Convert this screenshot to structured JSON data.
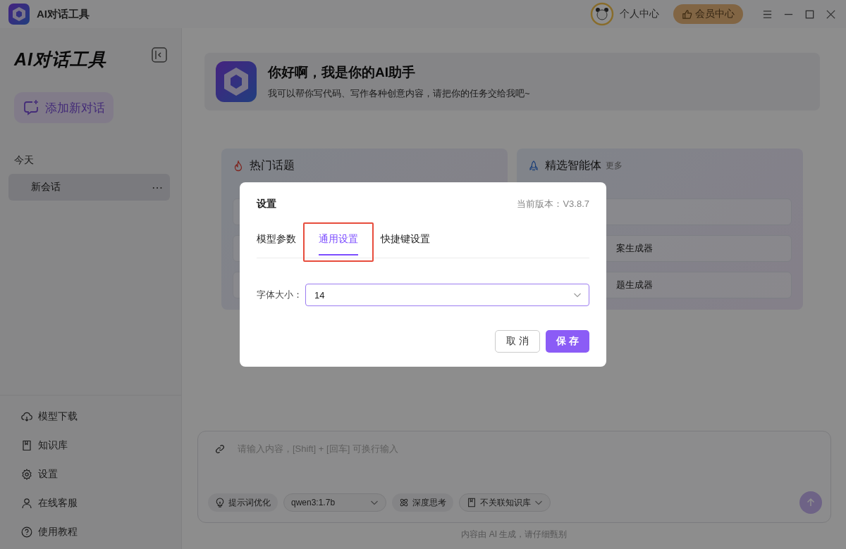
{
  "window": {
    "title": "AI对话工具"
  },
  "header": {
    "user_label": "个人中心",
    "vip_button": "会员中心"
  },
  "sidebar": {
    "logo": "AI对话工具",
    "new_chat_button": "添加新对话",
    "groups": [
      {
        "label": "今天",
        "items": [
          {
            "title": "新会话",
            "selected": true,
            "more": "⋯"
          }
        ]
      }
    ],
    "bottom_items": [
      {
        "kind": "cloud",
        "label": "模型下载"
      },
      {
        "kind": "book",
        "label": "知识库"
      },
      {
        "kind": "gear",
        "label": "设置"
      },
      {
        "kind": "person",
        "label": "在线客服"
      },
      {
        "kind": "help",
        "label": "使用教程"
      }
    ]
  },
  "welcome": {
    "title": "你好啊，我是你的AI助手",
    "subtitle": "我可以帮你写代码、写作各种创意内容，请把你的任务交给我吧~"
  },
  "cards": [
    {
      "kind": "fire",
      "title": "热门话题"
    },
    {
      "kind": "rocket",
      "title": "精选智能体",
      "more": "更多",
      "items": [
        "案生成器",
        "题生成器"
      ]
    }
  ],
  "composer": {
    "placeholder": "请输入内容，[Shift] + [回车] 可换行输入",
    "chips": [
      {
        "kind": "bulb",
        "label": "提示词优化"
      },
      {
        "kind": "select",
        "label": "qwen3:1.7b"
      },
      {
        "kind": "atom",
        "label": "深度思考"
      },
      {
        "kind": "book-select",
        "label": "不关联知识库"
      }
    ]
  },
  "footer_note": "内容由 AI 生成，请仔细甄别",
  "dialog": {
    "title": "设置",
    "version": "当前版本：V3.8.7",
    "tabs": [
      {
        "label": "模型参数",
        "selected": false,
        "highlighted": false
      },
      {
        "label": "通用设置",
        "selected": true,
        "highlighted": true
      },
      {
        "label": "快捷键设置",
        "selected": false,
        "highlighted": false
      }
    ],
    "field": {
      "label": "字体大小：",
      "value": "14"
    },
    "buttons": [
      {
        "kind": "cancel",
        "label": "取 消"
      },
      {
        "kind": "primary",
        "label": "保 存"
      }
    ]
  }
}
